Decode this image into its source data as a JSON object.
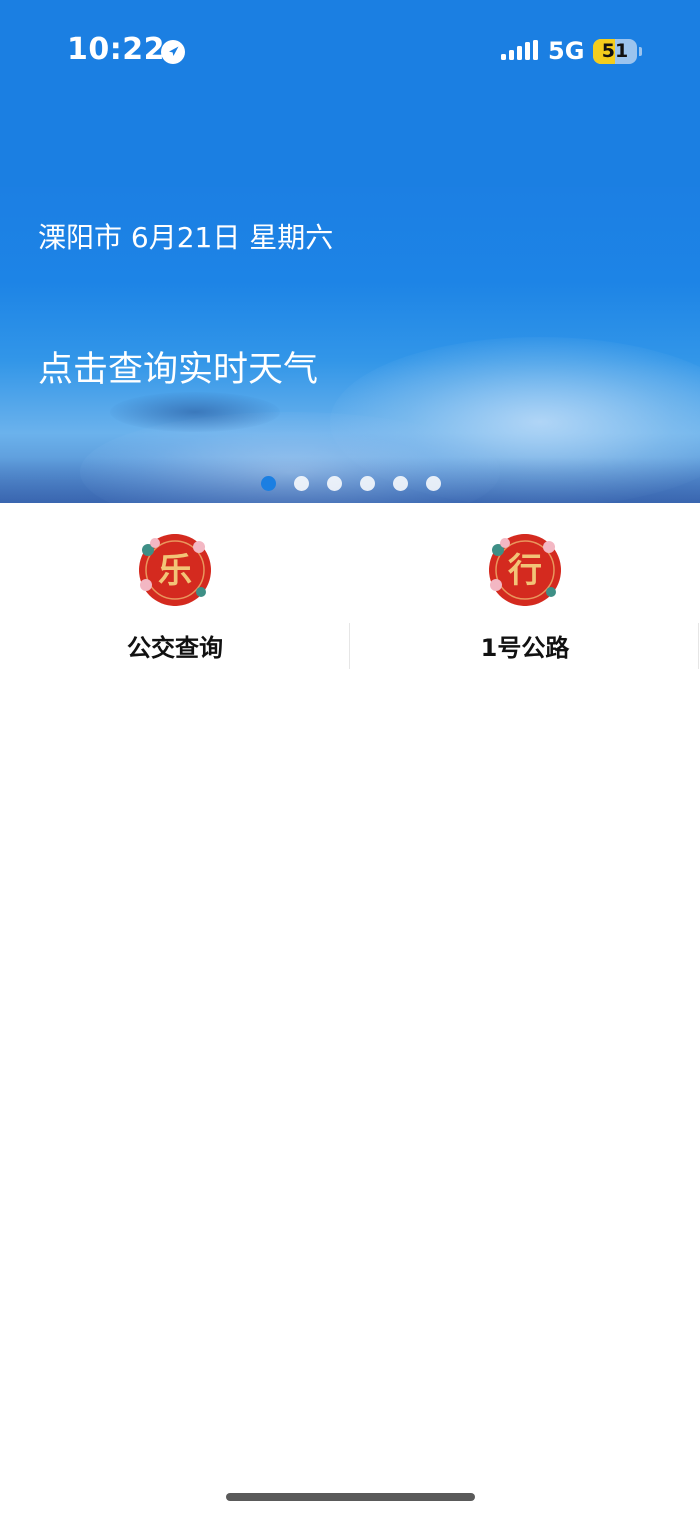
{
  "status_bar": {
    "time": "10:22",
    "network": "5G",
    "battery_level": "51",
    "battery_fraction": 0.51,
    "location_icon": "location-arrow-icon",
    "signal_icon": "cellular-signal-icon"
  },
  "banner": {
    "location_date": "溧阳市 6月21日 星期六",
    "prompt": "点击查询实时天气",
    "page_count": 6,
    "active_page": 0
  },
  "services": [
    {
      "label": "公交查询",
      "badge_char": "乐",
      "icon": "le-badge-icon"
    },
    {
      "label": "1号公路",
      "badge_char": "行",
      "icon": "xing-badge-icon"
    }
  ],
  "colors": {
    "primary_blue": "#1b7fe2",
    "badge_red": "#d42a1f",
    "badge_gold": "#f2c477",
    "text_dark": "#111111"
  }
}
